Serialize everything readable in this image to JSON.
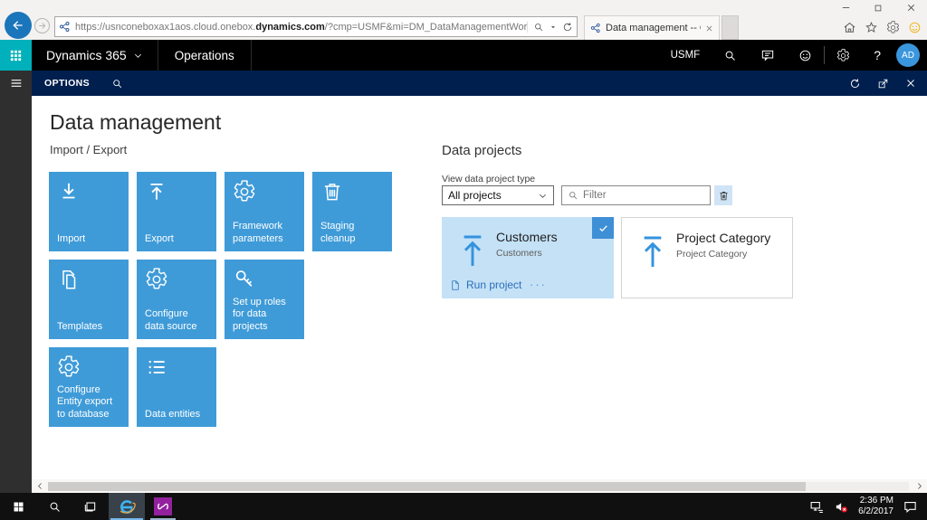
{
  "browser": {
    "url_prefix": "https://usnconeboxax1aos.cloud.onebox.",
    "url_domain": "dynamics.com",
    "url_suffix": "/?cmp=USMF&mi=DM_DataManagementWorkspaceMenuItem",
    "tab_title": "Data management -- Opera..."
  },
  "nav": {
    "brand": "Dynamics 365",
    "app": "Operations",
    "company": "USMF",
    "help": "?",
    "avatar_initials": "AD"
  },
  "options_bar": {
    "label": "OPTIONS"
  },
  "main": {
    "title": "Data management",
    "section": "Import / Export",
    "tiles": [
      {
        "label": "Import"
      },
      {
        "label": "Export"
      },
      {
        "label": "Framework parameters"
      },
      {
        "label": "Staging cleanup"
      },
      {
        "label": "Templates"
      },
      {
        "label": "Configure data source"
      },
      {
        "label": "Set up roles for data projects"
      },
      {
        "label": "Configure Entity export to database"
      },
      {
        "label": "Data entities"
      }
    ],
    "projects": {
      "title": "Data projects",
      "type_label": "View data project type",
      "type_value": "All projects",
      "filter_placeholder": "Filter",
      "cards": [
        {
          "title": "Customers",
          "subtitle": "Customers",
          "action": "Run project",
          "more": "···",
          "selected": true
        },
        {
          "title": "Project Category",
          "subtitle": "Project Category",
          "selected": false
        }
      ]
    }
  },
  "taskbar": {
    "time": "2:36 PM",
    "date": "6/2/2017"
  },
  "icons": {
    "apps": "grid",
    "back": "arrow-left",
    "forward": "arrow-right",
    "search": "magnifier",
    "refresh": "circular-arrow",
    "close": "x",
    "trash": "trash-can",
    "gear": "gear",
    "key": "key",
    "list": "bulleted-list",
    "copy": "pages",
    "check": "checkmark"
  },
  "colors": {
    "tile_blue": "#3f9bd8",
    "accent_teal": "#00b0ba",
    "options_navy": "#001f4e",
    "selected_card": "#c4e1f6",
    "check_blue": "#3f8fd6",
    "link_blue": "#2a6fbc",
    "avatar_blue": "#3a96dd",
    "back_blue": "#1b75bb"
  }
}
